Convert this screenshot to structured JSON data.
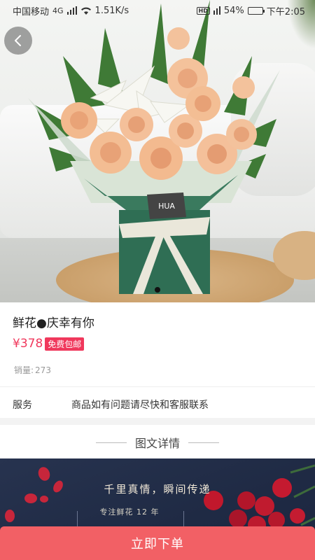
{
  "status_bar": {
    "carrier": "中国移动",
    "network": "4G",
    "speed": "1.51K/s",
    "hd": "HD",
    "battery": "54%",
    "battery_level": 0.54,
    "time": "下午2:05"
  },
  "icons": {
    "back": "chevron-left-icon",
    "wifi": "wifi-icon",
    "signal": "signal-icon",
    "battery": "battery-icon"
  },
  "product": {
    "image_logo": "HUA",
    "title": "鲜花●庆幸有你",
    "price": "¥378",
    "shipping_badge": "免费包邮",
    "sales_label": "销量:",
    "sales_value": "273",
    "service_label": "服务",
    "service_text": "商品如有问题请尽快和客服联系"
  },
  "detail": {
    "header": "图文详情",
    "banner_headline": "千里真情，瞬间传递",
    "banner_sub": "专注鲜花 12 年"
  },
  "order_button": {
    "label": "立即下单"
  },
  "colors": {
    "accent": "#f0385c",
    "order_button": "#f26065",
    "banner_bg": "#1f2a44"
  }
}
